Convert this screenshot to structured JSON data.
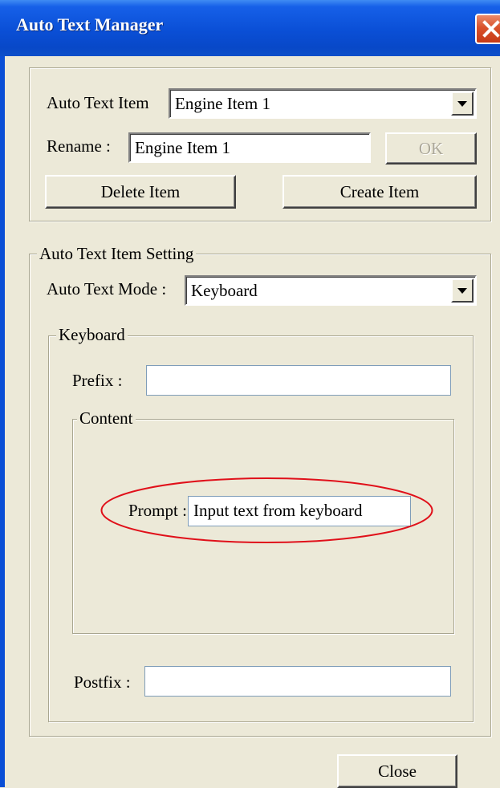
{
  "window": {
    "title": "Auto Text Manager"
  },
  "item_section": {
    "auto_text_item_label": "Auto Text Item",
    "auto_text_item_value": "Engine Item 1",
    "rename_label": "Rename :",
    "rename_value": "Engine Item 1",
    "ok_label": "OK",
    "delete_label": "Delete Item",
    "create_label": "Create Item"
  },
  "setting": {
    "group_label": "Auto Text Item Setting",
    "mode_label": "Auto Text Mode :",
    "mode_value": "Keyboard",
    "keyboard": {
      "group_label": "Keyboard",
      "prefix_label": "Prefix :",
      "prefix_value": "",
      "content": {
        "group_label": "Content",
        "prompt_label": "Prompt :",
        "prompt_value": "Input text from keyboard"
      },
      "postfix_label": "Postfix :",
      "postfix_value": ""
    }
  },
  "footer": {
    "close_label": "Close"
  },
  "annotation": {
    "highlight_color": "#e0101a"
  }
}
